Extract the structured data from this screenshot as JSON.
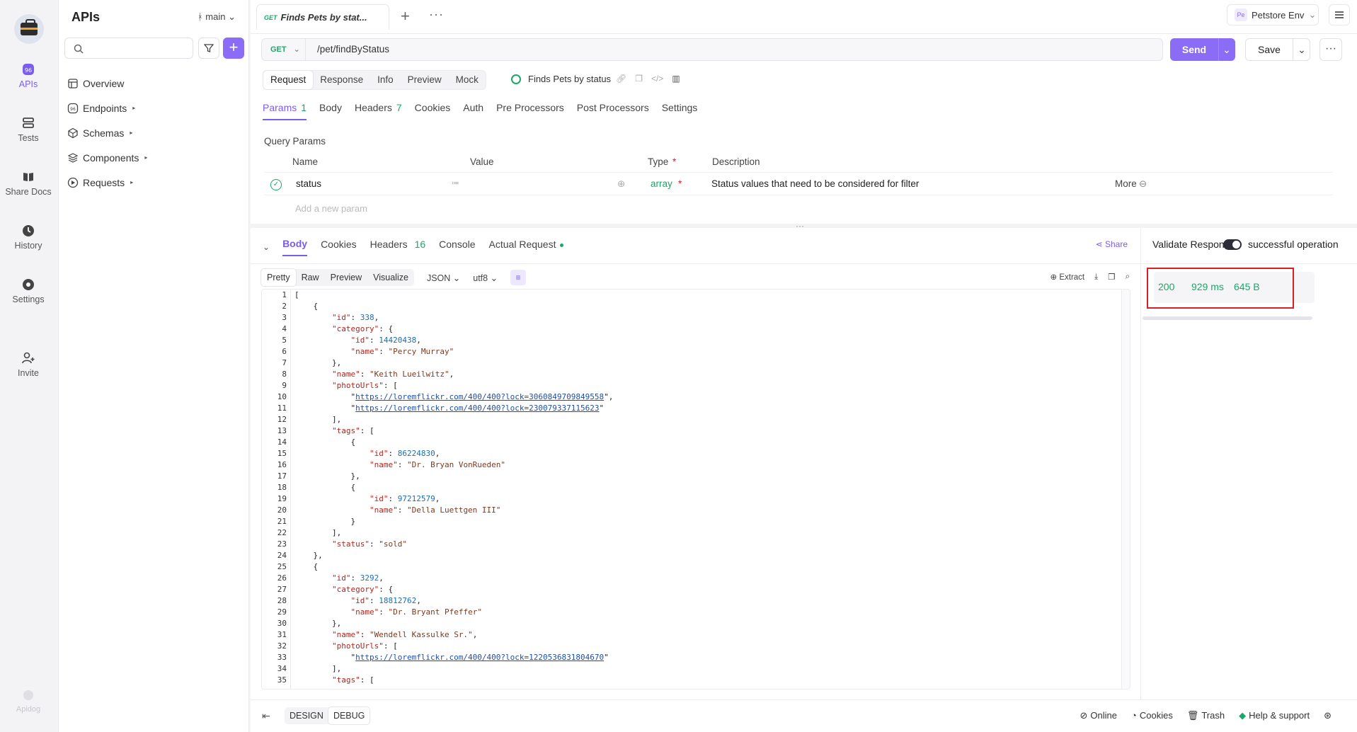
{
  "rail": {
    "items": [
      {
        "label": "APIs",
        "icon": "apis-icon"
      },
      {
        "label": "Tests",
        "icon": "tests-icon"
      },
      {
        "label": "Share Docs",
        "icon": "share-docs-icon"
      },
      {
        "label": "History",
        "icon": "history-icon"
      },
      {
        "label": "Settings",
        "icon": "settings-icon"
      },
      {
        "label": "Invite",
        "icon": "invite-icon"
      }
    ],
    "brand": "Apidog"
  },
  "sidebar": {
    "title": "APIs",
    "branch": "main",
    "search_placeholder": "",
    "items": [
      {
        "label": "Overview"
      },
      {
        "label": "Endpoints"
      },
      {
        "label": "Schemas"
      },
      {
        "label": "Components"
      },
      {
        "label": "Requests"
      }
    ]
  },
  "topbar": {
    "tab_method": "GET",
    "tab_title": "Finds Pets by stat...",
    "env_badge": "Pe",
    "env_name": "Petstore Env"
  },
  "request": {
    "method": "GET",
    "url": "/pet/findByStatus",
    "send_label": "Send",
    "save_label": "Save",
    "tabs": [
      "Request",
      "Response",
      "Info",
      "Preview",
      "Mock"
    ],
    "endpoint_name": "Finds Pets by status",
    "param_tabs": [
      {
        "label": "Params",
        "count": "1"
      },
      {
        "label": "Body",
        "count": ""
      },
      {
        "label": "Headers",
        "count": "7"
      },
      {
        "label": "Cookies",
        "count": ""
      },
      {
        "label": "Auth",
        "count": ""
      },
      {
        "label": "Pre Processors",
        "count": ""
      },
      {
        "label": "Post Processors",
        "count": ""
      },
      {
        "label": "Settings",
        "count": ""
      }
    ],
    "query_params_title": "Query Params",
    "columns": {
      "name": "Name",
      "value": "Value",
      "type": "Type",
      "description": "Description"
    },
    "param": {
      "name": "status",
      "type": "array",
      "description": "Status values that need to be considered for filter",
      "more": "More"
    },
    "add_param_placeholder": "Add a new param"
  },
  "response": {
    "tabs": [
      {
        "label": "Body",
        "count": ""
      },
      {
        "label": "Cookies",
        "count": ""
      },
      {
        "label": "Headers",
        "count": "16"
      },
      {
        "label": "Console",
        "count": ""
      },
      {
        "label": "Actual Request",
        "count": ""
      }
    ],
    "share_label": "Share",
    "format_tabs": [
      "Pretty",
      "Raw",
      "Preview",
      "Visualize"
    ],
    "format": "JSON",
    "encoding": "utf8",
    "extract_label": "Extract"
  },
  "validation": {
    "title": "Validate Response",
    "operation": "successful operation",
    "status_code": "200",
    "time": "929 ms",
    "size": "645 B"
  },
  "bottom": {
    "modes": [
      "DESIGN",
      "DEBUG"
    ],
    "items": [
      "Online",
      "Cookies",
      "Trash",
      "Help & support"
    ]
  },
  "code_lines": [
    "[",
    "    {",
    "        \"id\": 338,",
    "        \"category\": {",
    "            \"id\": 14420438,",
    "            \"name\": \"Percy Murray\"",
    "        },",
    "        \"name\": \"Keith Lueilwitz\",",
    "        \"photoUrls\": [",
    "            \"https://loremflickr.com/400/400?lock=3060849709849558\",",
    "            \"https://loremflickr.com/400/400?lock=2300793371156​23\"",
    "        ],",
    "        \"tags\": [",
    "            {",
    "                \"id\": 86224830,",
    "                \"name\": \"Dr. Bryan VonRueden\"",
    "            },",
    "            {",
    "                \"id\": 97212579,",
    "                \"name\": \"Della Luettgen III\"",
    "            }",
    "        ],",
    "        \"status\": \"sold\"",
    "    },",
    "    {",
    "        \"id\": 3292,",
    "        \"category\": {",
    "            \"id\": 18812762,",
    "            \"name\": \"Dr. Bryant Pfeffer\"",
    "        },",
    "        \"name\": \"Wendell Kassulke Sr.\",",
    "        \"photoUrls\": [",
    "            \"https://loremflickr.com/400/400?lock=1220536831804670\"",
    "        ],",
    "        \"tags\": ["
  ]
}
